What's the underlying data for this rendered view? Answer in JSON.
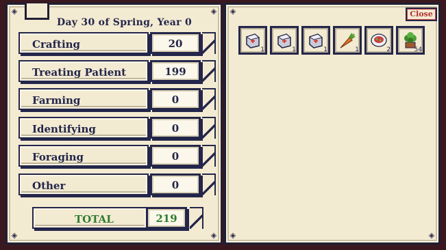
{
  "left_page": {
    "header": "Day 30 of Spring, Year 0",
    "rows": [
      {
        "label": "Crafting",
        "value": "20"
      },
      {
        "label": "Treating Patient",
        "value": "199"
      },
      {
        "label": "Farming",
        "value": "0"
      },
      {
        "label": "Identifying",
        "value": "0"
      },
      {
        "label": "Foraging",
        "value": "0"
      },
      {
        "label": "Other",
        "value": "0"
      }
    ],
    "total": {
      "label": "TOTAL",
      "value": "219"
    }
  },
  "right_page": {
    "close_label": "Close",
    "items": [
      {
        "icon": "medkit-icon",
        "count": "1"
      },
      {
        "icon": "medkit-icon",
        "count": "1"
      },
      {
        "icon": "medkit-icon",
        "count": "1"
      },
      {
        "icon": "carrot-icon",
        "count": "1"
      },
      {
        "icon": "salad-bowl-icon",
        "count": "2"
      },
      {
        "icon": "leafy-plant-icon",
        "count": "54"
      }
    ]
  },
  "colors": {
    "ink": "#23264a",
    "paper": "#f3ead2",
    "total_green": "#2f7d2f",
    "close_red": "#b43030"
  }
}
